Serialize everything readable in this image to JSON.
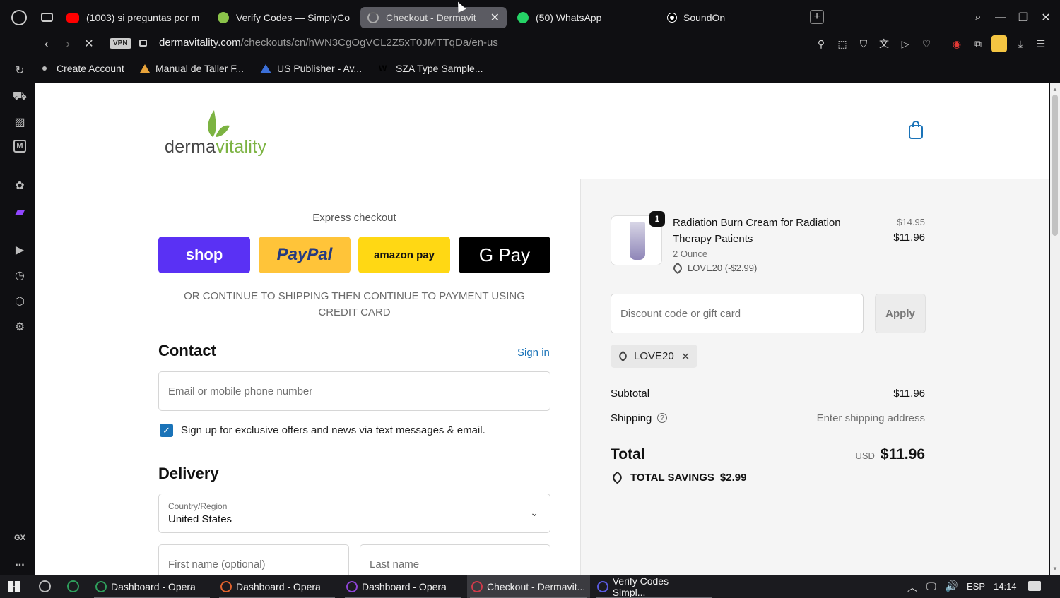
{
  "tabs": [
    {
      "label": "(1003) si preguntas por m",
      "icon": "youtube-icon"
    },
    {
      "label": "Verify Codes — SimplyCo",
      "icon": "simplycodes-icon"
    },
    {
      "label": "Checkout - Dermavit",
      "icon": "loading-icon"
    },
    {
      "label": "(50) WhatsApp",
      "icon": "whatsapp-icon"
    },
    {
      "label": "SoundOn",
      "icon": "soundon-icon"
    }
  ],
  "address": {
    "vpn": "VPN",
    "domain": "dermavitality.com",
    "path": "/checkouts/cn/hWN3CgOgVCL2Z5xT0JMTTqDa/en-us"
  },
  "bookmarks": [
    "Create Account",
    "Manual de Taller F...",
    "US Publisher - Av...",
    "SZA Type Sample..."
  ],
  "sidebar": {
    "gx": "GX",
    "more": "..."
  },
  "brand": {
    "part1": "derma",
    "part2": "vitality"
  },
  "express": {
    "title": "Express checkout",
    "shop": "shop",
    "paypal": "PayPal",
    "amazon": "amazon pay",
    "gpay": "G Pay",
    "note": "OR CONTINUE TO SHIPPING THEN CONTINUE TO PAYMENT USING CREDIT CARD"
  },
  "contact": {
    "title": "Contact",
    "signin": "Sign in",
    "email_placeholder": "Email or mobile phone number",
    "optin": "Sign up for exclusive offers and news via text messages & email."
  },
  "delivery": {
    "title": "Delivery",
    "country_label": "Country/Region",
    "country_value": "United States",
    "first_name": "First name (optional)",
    "last_name": "Last name"
  },
  "summary": {
    "qty": "1",
    "product": "Radiation Burn Cream for Radiation Therapy Patients",
    "variant": "2 Ounce",
    "discount_line": "LOVE20 (-$2.99)",
    "old_price": "$14.95",
    "price": "$11.96",
    "discount_placeholder": "Discount code or gift card",
    "apply": "Apply",
    "code_tag": "LOVE20",
    "subtotal_label": "Subtotal",
    "subtotal": "$11.96",
    "shipping_label": "Shipping",
    "shipping": "Enter shipping address",
    "total_label": "Total",
    "currency": "USD",
    "total": "$11.96",
    "savings_label": "TOTAL SAVINGS",
    "savings": "$2.99"
  },
  "taskbar": {
    "items": [
      "Dashboard - Opera",
      "Dashboard - Opera",
      "Dashboard - Opera",
      "Checkout - Dermavit...",
      "Verify Codes — Simpl..."
    ],
    "lang": "ESP",
    "time": "14:14"
  },
  "colors": {
    "shop": "#5a31f4",
    "paypal": "#ffc439",
    "amazon": "#ffd814",
    "gpay": "#000000",
    "brand_green": "#7cb342",
    "link": "#1a73b8"
  }
}
